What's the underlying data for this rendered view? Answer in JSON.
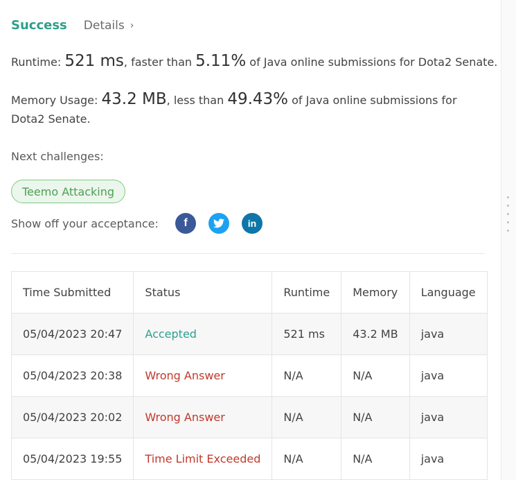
{
  "header": {
    "status": "Success",
    "details_link": "Details",
    "chevron": "›"
  },
  "runtime": {
    "label": "Runtime:",
    "value": "521 ms",
    "faster_text": ", faster than",
    "percent": "5.11%",
    "suffix": "of Java online submissions for Dota2 Senate."
  },
  "memory": {
    "label": "Memory Usage:",
    "value": "43.2 MB",
    "less_text": ", less than",
    "percent": "49.43%",
    "suffix": "of Java online submissions for Dota2 Senate."
  },
  "next": {
    "label": "Next challenges:",
    "challenge": "Teemo Attacking"
  },
  "share": {
    "label": "Show off your acceptance:",
    "icons": [
      "facebook-icon",
      "twitter-icon",
      "linkedin-icon"
    ],
    "glyphs": {
      "facebook": "f",
      "twitter": "t",
      "linkedin": "in"
    }
  },
  "table": {
    "headers": [
      "Time Submitted",
      "Status",
      "Runtime",
      "Memory",
      "Language"
    ],
    "rows": [
      {
        "time": "05/04/2023 20:47",
        "status": "Accepted",
        "runtime": "521 ms",
        "memory": "43.2 MB",
        "language": "java"
      },
      {
        "time": "05/04/2023 20:38",
        "status": "Wrong Answer",
        "runtime": "N/A",
        "memory": "N/A",
        "language": "java"
      },
      {
        "time": "05/04/2023 20:02",
        "status": "Wrong Answer",
        "runtime": "N/A",
        "memory": "N/A",
        "language": "java"
      },
      {
        "time": "05/04/2023 19:55",
        "status": "Time Limit Exceeded",
        "runtime": "N/A",
        "memory": "N/A",
        "language": "java"
      }
    ]
  },
  "colors": {
    "accent": "#2d9f8c",
    "error": "#c0392b",
    "chip_green": "#4c9f54"
  }
}
